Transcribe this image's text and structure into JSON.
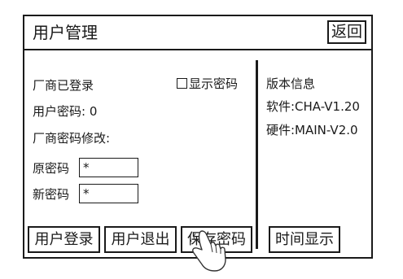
{
  "header": {
    "title": "用户管理",
    "back_label": "返回"
  },
  "left": {
    "vendor_logged_in": "厂商已登录",
    "show_password_label": "显示密码",
    "user_password_label": "用户密码: 0",
    "vendor_password_change": "厂商密码修改:",
    "old_password_label": "原密码",
    "old_password_value": "*",
    "new_password_label": "新密码",
    "new_password_value": "*"
  },
  "right": {
    "version_title": "版本信息",
    "software": "软件:CHA-V1.20",
    "hardware": "硬件:MAIN-V2.0"
  },
  "buttons": {
    "user_login": "用户登录",
    "user_logout": "用户退出",
    "save_password": "保存密码",
    "time_display": "时间显示"
  }
}
